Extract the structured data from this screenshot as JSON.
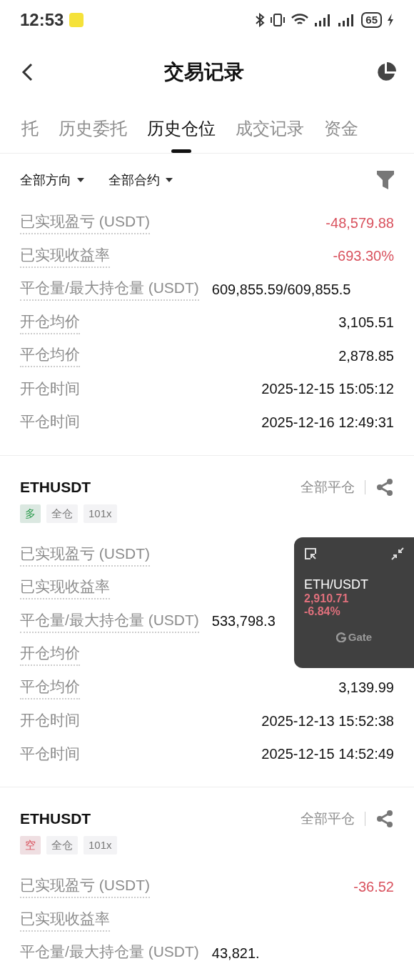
{
  "status_bar": {
    "time": "12:53",
    "battery": "65"
  },
  "header": {
    "title": "交易记录"
  },
  "tabs": [
    {
      "label": "托",
      "selected": false
    },
    {
      "label": "历史委托",
      "selected": false
    },
    {
      "label": "历史仓位",
      "selected": true
    },
    {
      "label": "成交记录",
      "selected": false
    },
    {
      "label": "资金",
      "selected": false
    }
  ],
  "filters": [
    {
      "label": "全部方向"
    },
    {
      "label": "全部合约"
    }
  ],
  "positions": [
    {
      "rows": [
        {
          "kind": "plain",
          "label": "已实现盈亏 (USDT)",
          "hint": true,
          "value": "-48,579.88",
          "color": "#d9525e"
        },
        {
          "kind": "plain",
          "label": "已实现收益率",
          "hint": true,
          "value": "-693.30%",
          "color": "#d9525e"
        },
        {
          "kind": "ratio",
          "label": "平仓量/最大持仓量 (USDT)",
          "hint": true,
          "value": "609,855.59/609,855.5"
        },
        {
          "kind": "plain",
          "label": "开仓均价",
          "hint": true,
          "value": "3,105.51"
        },
        {
          "kind": "plain",
          "label": "平仓均价",
          "hint": true,
          "value": "2,878.85"
        },
        {
          "kind": "plain",
          "label": "开仓时间",
          "hint": false,
          "value": "2025-12-15 15:05:12"
        },
        {
          "kind": "plain",
          "label": "平仓时间",
          "hint": false,
          "value": "2025-12-16 12:49:31"
        }
      ]
    },
    {
      "symbol": "ETHUSDT",
      "close_all": "全部平仓",
      "side": {
        "label": "多",
        "color": "#2e9c4f"
      },
      "tags": [
        "全仓",
        "101x"
      ],
      "rows": [
        {
          "kind": "plain",
          "label": "已实现盈亏 (USDT)",
          "hint": true
        },
        {
          "kind": "plain",
          "label": "已实现收益率",
          "hint": true
        },
        {
          "kind": "ratio",
          "label": "平仓量/最大持仓量 (USDT)",
          "hint": true,
          "value": "533,798.3"
        },
        {
          "kind": "plain",
          "label": "开仓均价",
          "hint": true
        },
        {
          "kind": "plain",
          "label": "平仓均价",
          "hint": true,
          "value": "3,139.99"
        },
        {
          "kind": "plain",
          "label": "开仓时间",
          "hint": false,
          "value": "2025-12-13 15:52:38"
        },
        {
          "kind": "plain",
          "label": "平仓时间",
          "hint": false,
          "value": "2025-12-15 14:52:49"
        }
      ]
    },
    {
      "symbol": "ETHUSDT",
      "close_all": "全部平仓",
      "side": {
        "label": "空",
        "color": "#d9525e"
      },
      "tags": [
        "全仓",
        "101x"
      ],
      "rows": [
        {
          "kind": "plain",
          "label": "已实现盈亏 (USDT)",
          "hint": true,
          "value": "-36.52",
          "color": "#d9525e"
        },
        {
          "kind": "plain",
          "label": "已实现收益率",
          "hint": true
        },
        {
          "kind": "ratio",
          "label": "平仓量/最大持仓量 (USDT)",
          "hint": true,
          "value": "43,821."
        }
      ]
    }
  ],
  "ticker_widget": {
    "pair": "ETH/USDT",
    "price": "2,910.71",
    "change": "-6.84%",
    "brand": "Gate"
  }
}
